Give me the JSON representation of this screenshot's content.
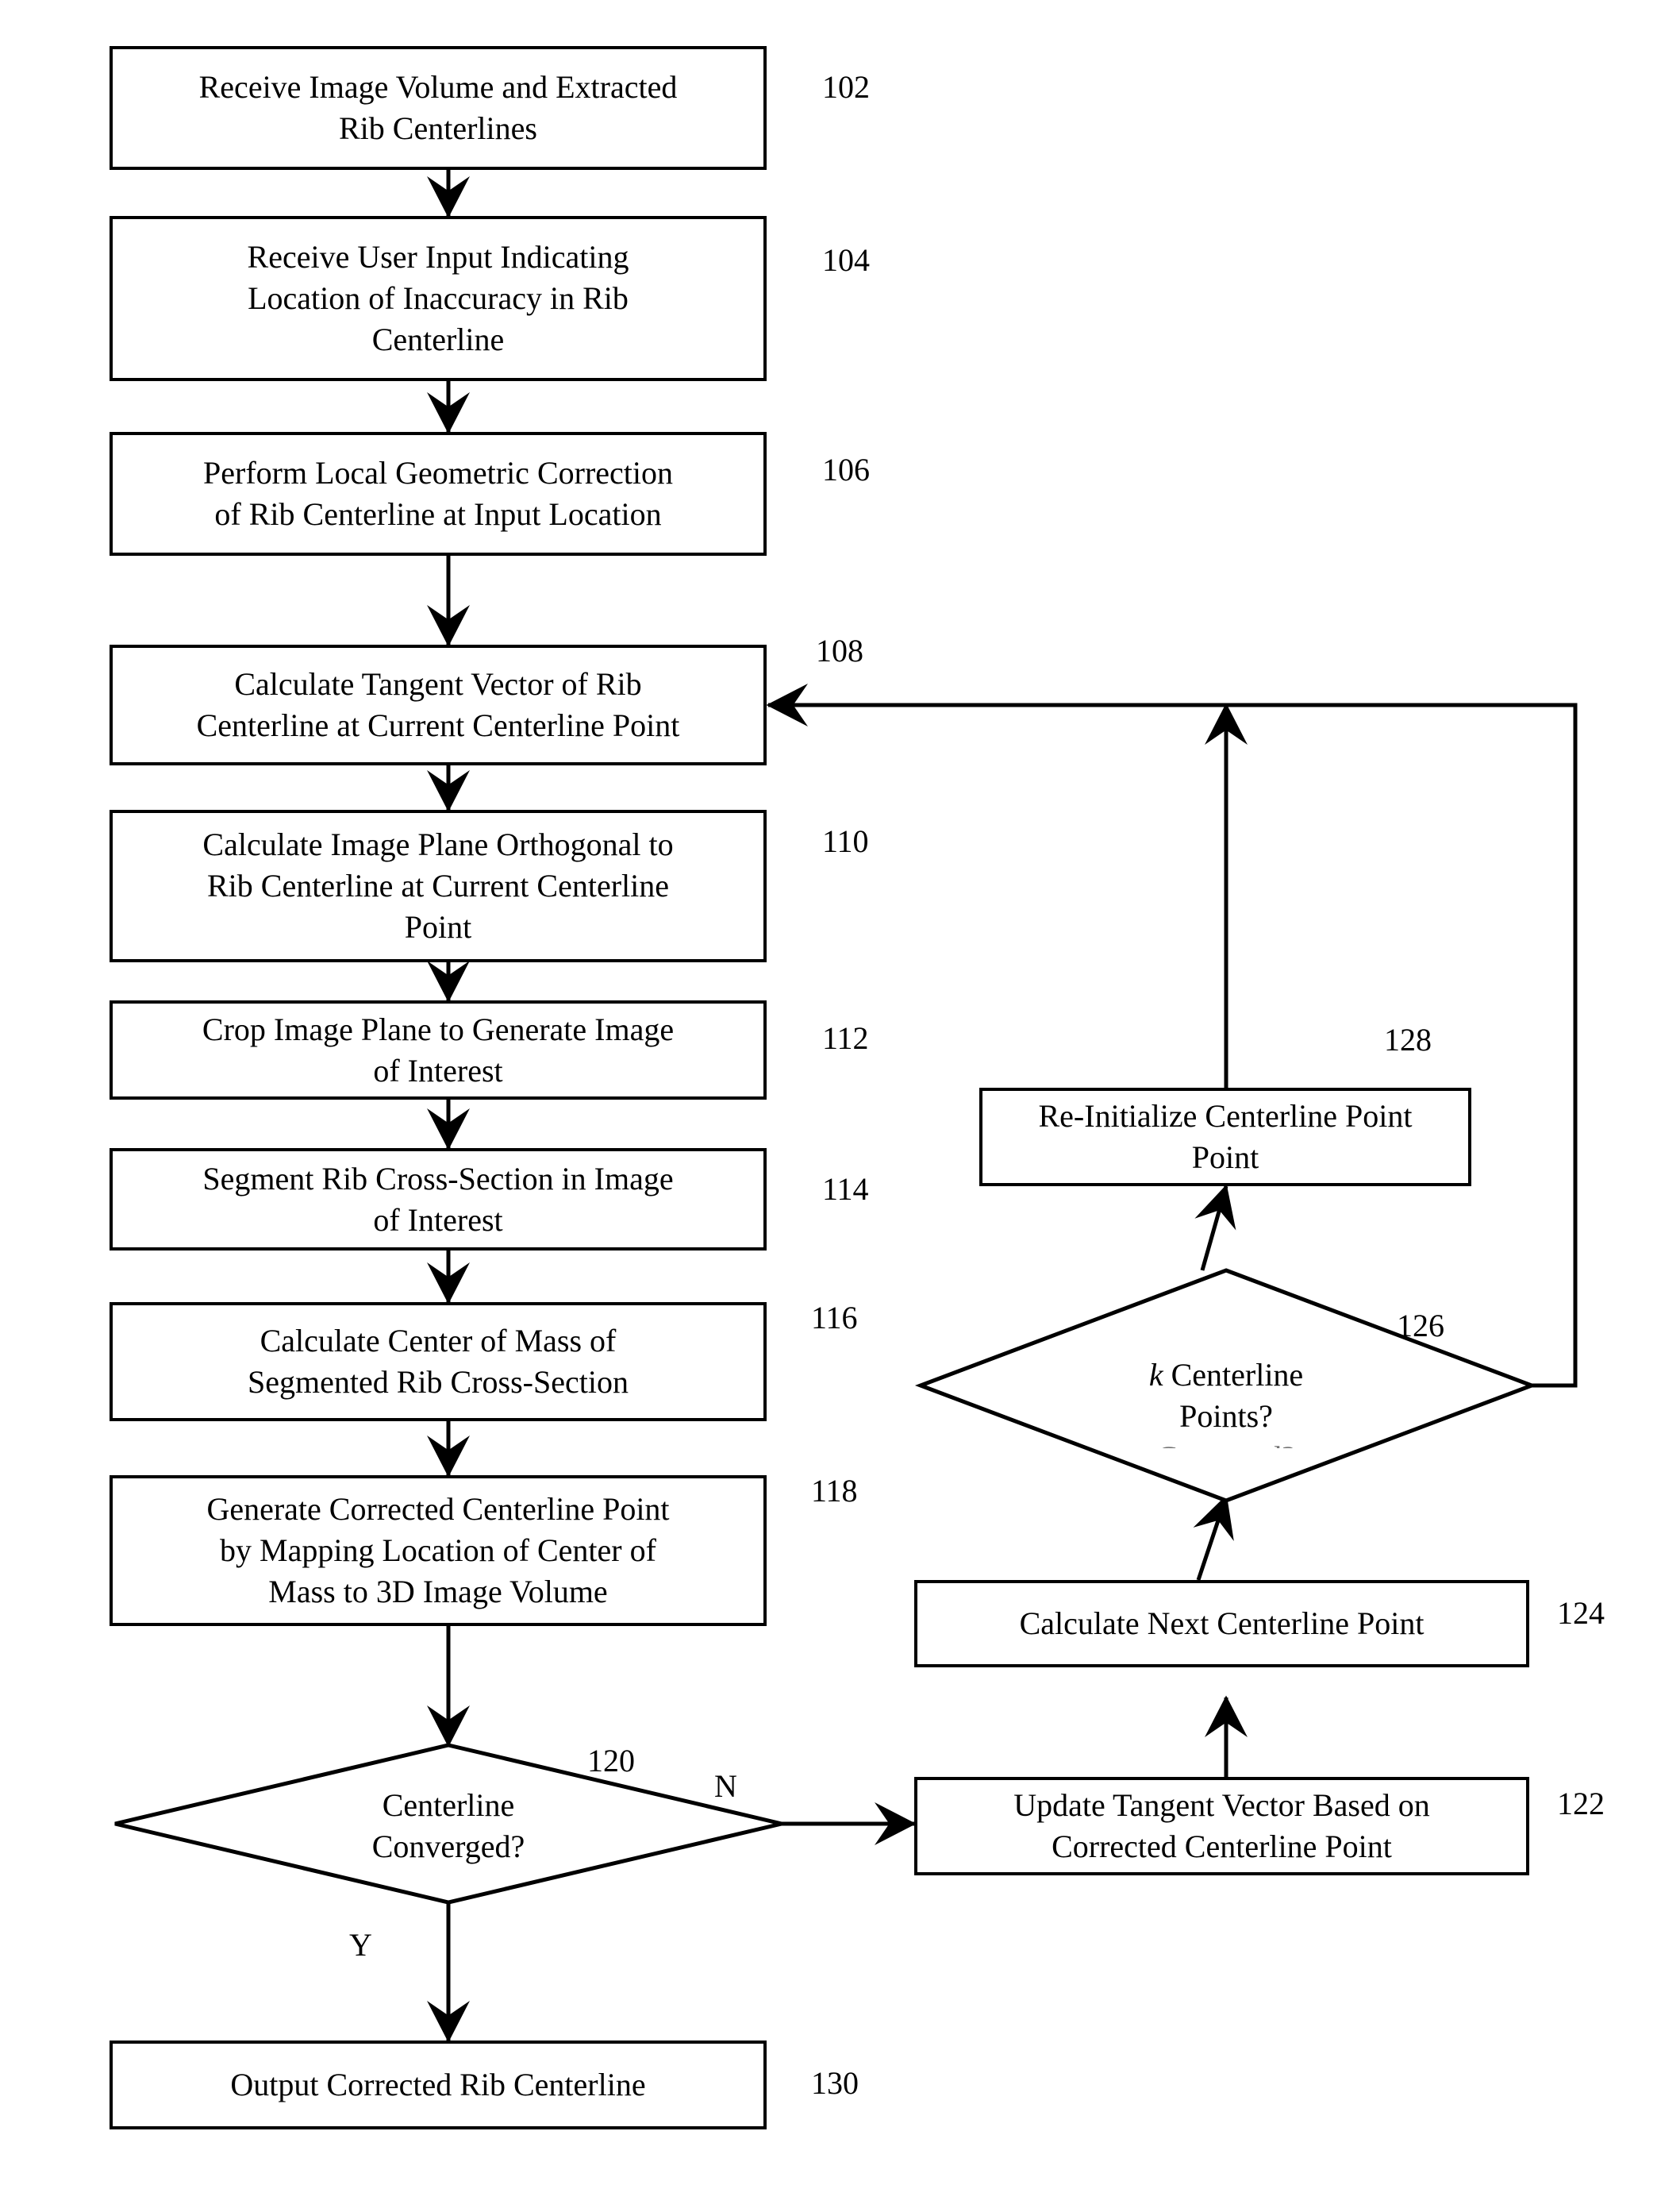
{
  "figure": {
    "type": "flowchart",
    "orientation": "vertical-with-feedback-loop",
    "nodes": [
      {
        "ref": "102",
        "shape": "process",
        "text": "Receive Image Volume and Extracted Rib Centerlines"
      },
      {
        "ref": "104",
        "shape": "process",
        "text": "Receive User Input Indicating Location of Inaccuracy in Rib Centerline"
      },
      {
        "ref": "106",
        "shape": "process",
        "text": "Perform Local Geometric Correction of Rib Centerline at Input Location"
      },
      {
        "ref": "108",
        "shape": "process",
        "text": "Calculate Tangent Vector of Rib Centerline at Current Centerline Point"
      },
      {
        "ref": "110",
        "shape": "process",
        "text": "Calculate Image Plane Orthogonal to Rib Centerline at Current Centerline Point"
      },
      {
        "ref": "112",
        "shape": "process",
        "text": "Crop Image Plane to Generate Image of Interest"
      },
      {
        "ref": "114",
        "shape": "process",
        "text": "Segment Rib Cross-Section in Image of Interest"
      },
      {
        "ref": "116",
        "shape": "process",
        "text": "Calculate Center of Mass of Segmented Rib Cross-Section"
      },
      {
        "ref": "118",
        "shape": "process",
        "text": "Generate Corrected Centerline Point by Mapping Location of Center of Mass to 3D Image Volume"
      },
      {
        "ref": "120",
        "shape": "decision",
        "text": "Centerline Converged?"
      },
      {
        "ref": "122",
        "shape": "process",
        "text": "Update Tangent Vector Based on Corrected Centerline Point"
      },
      {
        "ref": "124",
        "shape": "process",
        "text": "Calculate Next Centerline Point"
      },
      {
        "ref": "126",
        "shape": "decision",
        "text": "k Centerline Points?"
      },
      {
        "ref": "128",
        "shape": "process",
        "text": "Re-Initialize Centerline Point"
      },
      {
        "ref": "130",
        "shape": "process",
        "text": "Output Corrected Rib Centerline"
      }
    ],
    "edge_labels": {
      "decision_120_no": "N",
      "decision_120_yes": "Y"
    }
  },
  "boxes": {
    "b102": {
      "line1": "Receive Image Volume and Extracted",
      "line2": "Rib Centerlines",
      "ref": "102"
    },
    "b104": {
      "line1": "Receive User Input Indicating",
      "line2": "Location of Inaccuracy in Rib",
      "line3": "Centerline",
      "ref": "104"
    },
    "b106": {
      "line1": "Perform Local Geometric Correction",
      "line2": "of Rib Centerline at Input Location",
      "ref": "106"
    },
    "b108": {
      "line1": "Calculate Tangent Vector of Rib",
      "line2": "Centerline at Current Centerline Point",
      "ref": "108"
    },
    "b110": {
      "line1": "Calculate Image Plane Orthogonal to",
      "line2": "Rib Centerline at Current Centerline",
      "line3": "Point",
      "ref": "110"
    },
    "b112": {
      "line1": "Crop Image Plane to Generate Image",
      "line2": "of Interest",
      "ref": "112"
    },
    "b114": {
      "line1": "Segment Rib Cross-Section in Image",
      "line2": "of Interest",
      "ref": "114"
    },
    "b116": {
      "line1": "Calculate Center of Mass of",
      "line2": "Segmented Rib Cross-Section",
      "ref": "116"
    },
    "b118": {
      "line1": "Generate Corrected Centerline Point",
      "line2": "by Mapping Location of Center of",
      "line3": "Mass to 3D Image Volume",
      "ref": "118"
    },
    "b122": {
      "line1": "Update Tangent Vector Based on",
      "line2": "Corrected Centerline Point",
      "ref": "122"
    },
    "b124": {
      "line1": "Calculate Next Centerline Point",
      "ref": "124"
    },
    "b128": {
      "line1": "Re-Initialize Centerline Point",
      "line2": "Point",
      "ref": "128"
    },
    "b130": {
      "line1": "Output Corrected Rib Centerline",
      "ref": "130"
    }
  },
  "diamonds": {
    "d120": {
      "line1": "Centerline",
      "line2": "Converged?",
      "ref": "120",
      "yes_label": "Y",
      "no_label": "N"
    },
    "d126": {
      "k": "k",
      "line1": " Centerline",
      "line2": "Points?",
      "line3": "Corrected?",
      "ref": "126"
    }
  }
}
